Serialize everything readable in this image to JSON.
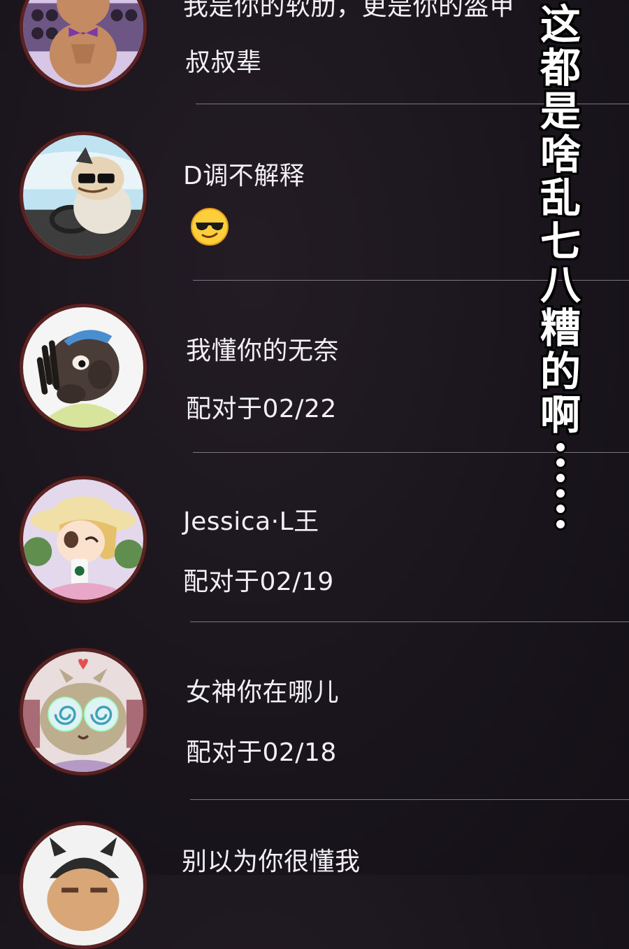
{
  "caption": [
    "这",
    "都",
    "是",
    "啥",
    "乱",
    "七",
    "八",
    "糟",
    "的",
    "啊"
  ],
  "caption_ellipsis": "……",
  "matches": [
    {
      "name": "我是你的软肋，更是你的盔甲",
      "detail": "叔叔辈",
      "avatar": "muscle-cat-avatar"
    },
    {
      "name": "D调不解释",
      "detail": "",
      "emoji": "sunglasses-emoji",
      "avatar": "driver-cat-avatar"
    },
    {
      "name": "我懂你的无奈",
      "detail": "配对于02/22",
      "avatar": "dreadlocks-cat-avatar"
    },
    {
      "name": "Jessica·L王",
      "detail": "配对于02/19",
      "avatar": "hat-girl-avatar"
    },
    {
      "name": "女神你在哪儿",
      "detail": "配对于02/18",
      "avatar": "hypno-cat-avatar"
    },
    {
      "name": "别以为你很懂我",
      "detail": "",
      "avatar": "beanie-cat-avatar"
    }
  ],
  "colors": {
    "background": "#1a151d",
    "divider": "#7b7680",
    "avatar_ring": "#5a2323",
    "text": "#f2f0f2"
  }
}
